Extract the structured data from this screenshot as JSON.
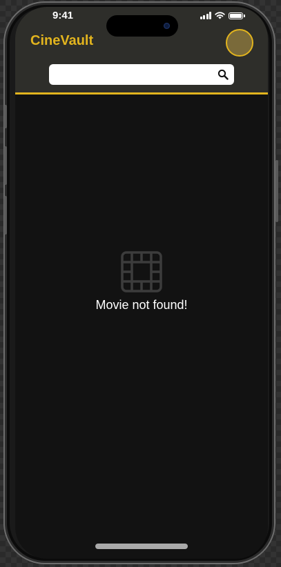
{
  "status_bar": {
    "time": "9:41"
  },
  "header": {
    "app_title": "CineVault",
    "accent_color": "#e2b41e"
  },
  "search": {
    "value": "",
    "placeholder": "",
    "icon": "search-icon"
  },
  "empty_state": {
    "icon": "film-icon",
    "message": "Movie not found!"
  }
}
